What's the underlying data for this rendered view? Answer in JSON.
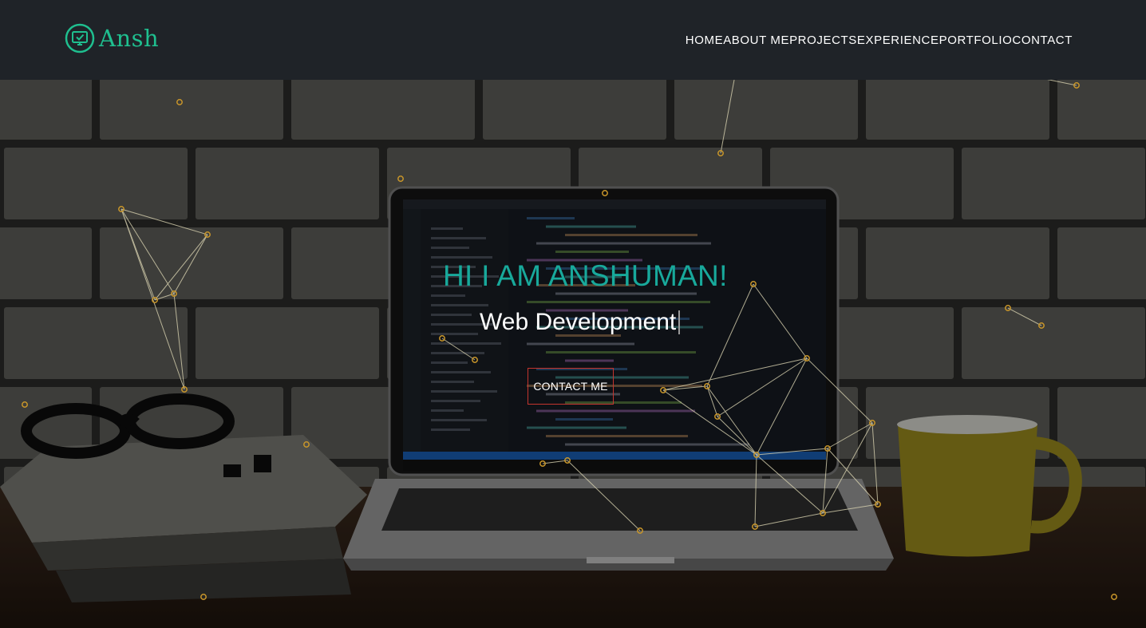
{
  "brand": {
    "name": "Ansh",
    "icon": "monitor-check-icon",
    "color": "#1fbf8f"
  },
  "nav": {
    "items": [
      {
        "label": "HOME"
      },
      {
        "label": "ABOUT ME"
      },
      {
        "label": "PROJECTS"
      },
      {
        "label": "EXPERIENCE"
      },
      {
        "label": "PORTFOLIO"
      },
      {
        "label": "CONTACT"
      }
    ]
  },
  "hero": {
    "title": "HI I AM ANSHUMAN!",
    "typed_text": "Web Development",
    "cta_label": "CONTACT ME",
    "title_color": "#18a99b",
    "cta_border_color": "#c4352e"
  },
  "colors": {
    "navbar_bg": "#1f2328",
    "particle_color": "#c9962a",
    "line_color": "#d8d2b0"
  }
}
